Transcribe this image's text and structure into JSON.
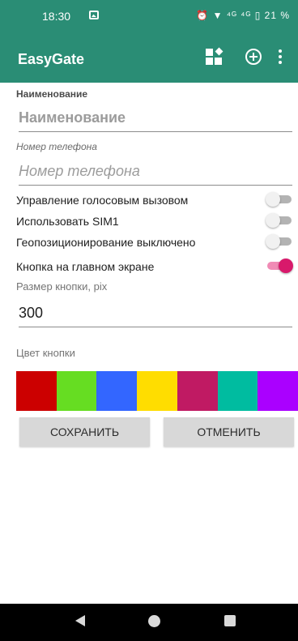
{
  "status_bar": {
    "time": "18:30",
    "right_icons": "⏰ ▼ ⁴ᴳ ⁴ᴳ ▯ 21 %"
  },
  "app_bar": {
    "title": "EasyGate",
    "icons": [
      "dashboard-icon",
      "add-circle-icon",
      "more-vertical-icon"
    ]
  },
  "form": {
    "name_label": "Наименование",
    "name_placeholder": "Наименование",
    "phone_label": "Номер телефона",
    "phone_placeholder": "Номер телефона",
    "switches": [
      {
        "label": "Управление голосовым вызовом",
        "checked": false
      },
      {
        "label": "Использовать SIM1",
        "checked": false
      },
      {
        "label": "Геопозиционирование выключено",
        "checked": false
      },
      {
        "label": "Кнопка на главном экране",
        "checked": true
      }
    ],
    "size_label": "Размер кнопки, pix",
    "size_value": "300",
    "color_label": "Цвет кнопки",
    "colors": [
      "#cc0000",
      "#66dd22",
      "#3366ff",
      "#ffdd00",
      "#c01a63",
      "#00bca0",
      "#aa00ff"
    ]
  },
  "buttons": {
    "save": "СОХРАНИТЬ",
    "cancel": "ОТМЕНИТЬ"
  },
  "theme": {
    "primary": "#2a8d75",
    "accent": "#d8196b"
  }
}
